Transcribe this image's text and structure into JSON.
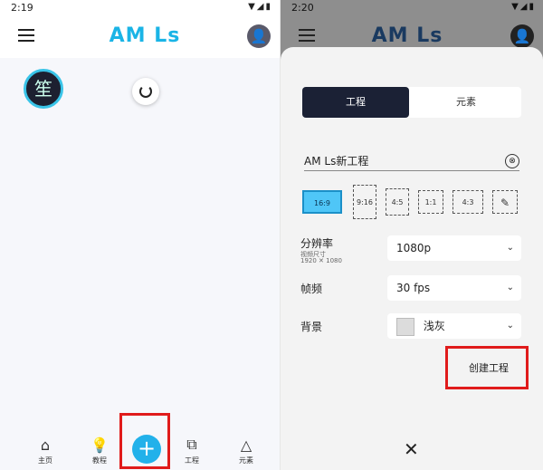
{
  "left": {
    "status": {
      "time": "2:19",
      "icons": "▼◢▮"
    },
    "logo": "AM Ls",
    "avatar_char": "笙",
    "nav": [
      {
        "label": "主页"
      },
      {
        "label": "教程"
      },
      {
        "label": "工程"
      },
      {
        "label": "元素"
      }
    ],
    "fab": "+"
  },
  "right": {
    "status": {
      "time": "2:20",
      "icons": "▼◢▮"
    },
    "logo": "AM Ls",
    "tabs": [
      "工程",
      "元素"
    ],
    "project_name": "AM Ls新工程",
    "clear_symbol": "⊗",
    "ratios": [
      "16:9",
      "9:16",
      "4:5",
      "1:1",
      "4:3"
    ],
    "resolution": {
      "label": "分辨率",
      "sub": "视频尺寸",
      "sub2": "1920 ✕ 1080",
      "value": "1080p"
    },
    "fps": {
      "label": "帧频",
      "value": "30 fps"
    },
    "background": {
      "label": "背景",
      "value": "浅灰"
    },
    "create_label": "创建工程",
    "close_symbol": "✕"
  },
  "colors": {
    "accent": "#22b1ea",
    "highlight": "#e01b1b",
    "dark": "#1b2135"
  }
}
